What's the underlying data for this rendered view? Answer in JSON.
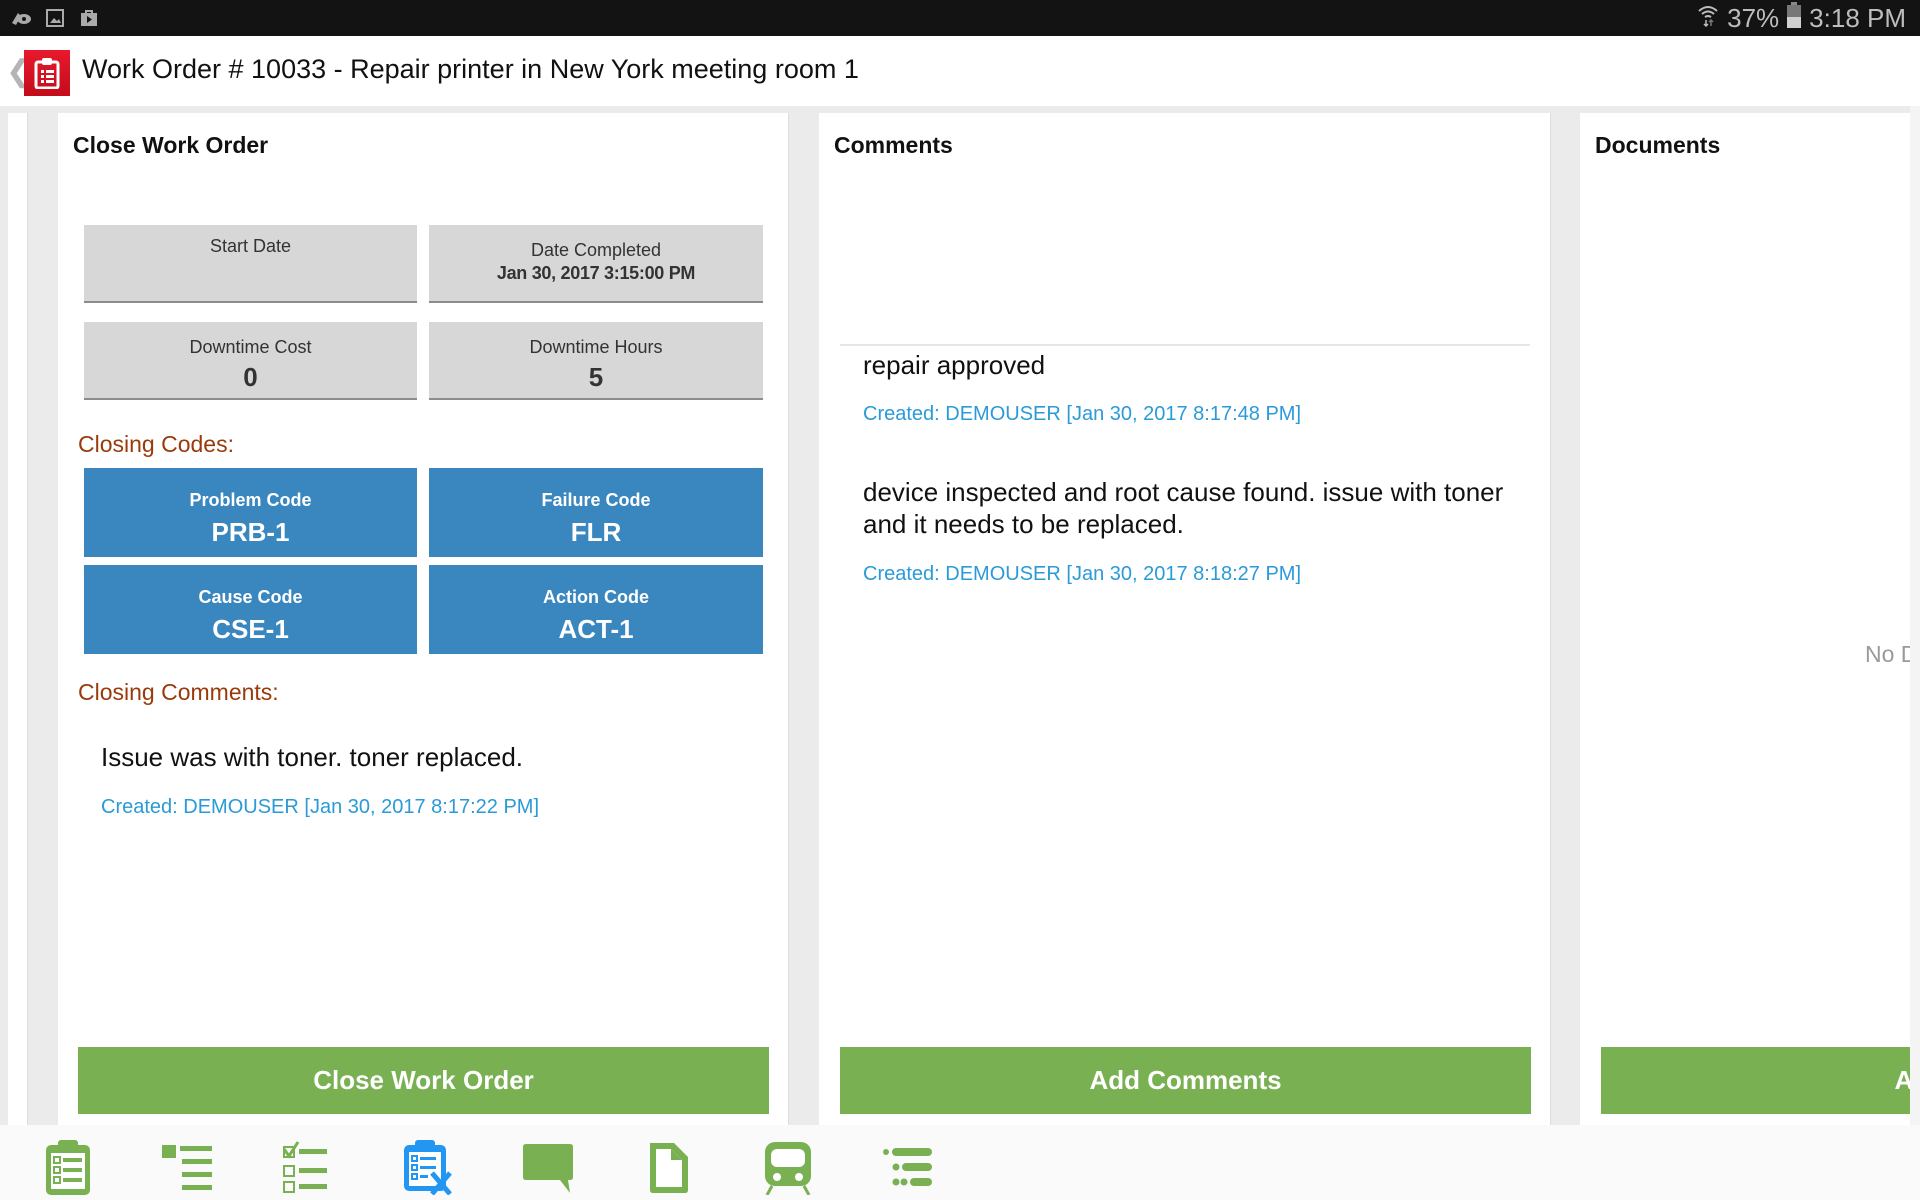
{
  "status_bar": {
    "left_icons": [
      "game-tools-icon",
      "image-icon",
      "store-bag-icon"
    ],
    "wifi_icon": "wifi-icon",
    "battery_percent": "37%",
    "battery_icon": "battery-icon",
    "time": "3:18 PM"
  },
  "header": {
    "back_icon": "chevron-left-icon",
    "app_icon": "clipboard-icon",
    "title": "Work Order # 10033 - Repair printer in New York meeting room 1",
    "accent_color": "#e8192c"
  },
  "close_panel": {
    "title": "Close Work Order",
    "fields": [
      {
        "label": "Start Date",
        "value": ""
      },
      {
        "label": "Date Completed",
        "value": "Jan 30, 2017 3:15:00 PM"
      },
      {
        "label": "Downtime Cost",
        "value": "0"
      },
      {
        "label": "Downtime Hours",
        "value": "5"
      }
    ],
    "closing_codes_label": "Closing Codes:",
    "codes": [
      {
        "label": "Problem Code",
        "value": "PRB-1"
      },
      {
        "label": "Failure Code",
        "value": "FLR"
      },
      {
        "label": "Cause Code",
        "value": "CSE-1"
      },
      {
        "label": "Action Code",
        "value": "ACT-1"
      }
    ],
    "closing_comments_label": "Closing Comments:",
    "closing_comment": {
      "text": "Issue was with toner. toner replaced.",
      "meta": "Created: DEMOUSER [Jan 30, 2017 8:17:22 PM]"
    },
    "button_label": "Close Work Order"
  },
  "comments_panel": {
    "title": "Comments",
    "comments": [
      {
        "text": "repair approved",
        "meta": "Created: DEMOUSER [Jan 30, 2017 8:17:48 PM]"
      },
      {
        "text": "device inspected and root cause found. issue with toner and it needs to be replaced.",
        "meta": "Created: DEMOUSER [Jan 30, 2017 8:18:27 PM]"
      }
    ],
    "button_label": "Add Comments"
  },
  "documents_panel": {
    "title": "Documents",
    "empty_text": "No D",
    "button_label": "Add"
  },
  "bottom_nav": {
    "items": [
      {
        "icon": "clipboard-checklist-icon",
        "active": false
      },
      {
        "icon": "list-icon",
        "active": false
      },
      {
        "icon": "checklist-icon",
        "active": false
      },
      {
        "icon": "clipboard-close-icon",
        "active": true
      },
      {
        "icon": "comment-icon",
        "active": false
      },
      {
        "icon": "document-icon",
        "active": false
      },
      {
        "icon": "train-icon",
        "active": false
      },
      {
        "icon": "tree-list-icon",
        "active": false
      }
    ],
    "color": "#79b052",
    "active_color": "#2196f3"
  },
  "colors": {
    "button_green": "#79b052",
    "code_blue": "#3a87c0",
    "section_label": "#9a3a0a",
    "meta_blue": "#2a9ad8"
  }
}
